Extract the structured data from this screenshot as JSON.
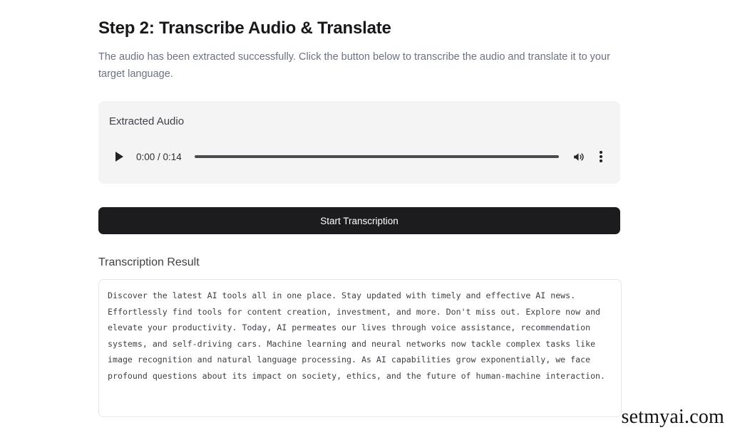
{
  "page": {
    "title": "Step 2: Transcribe Audio & Translate",
    "description": "The audio has been extracted successfully. Click the button below to transcribe the audio and translate it to your target language."
  },
  "audio_card": {
    "label": "Extracted Audio",
    "player": {
      "play_icon": "play-icon",
      "current_time": "0:00",
      "duration": "0:14",
      "time_display": "0:00 / 0:14",
      "progress_percent": 0,
      "volume_icon": "volume-icon",
      "more_icon": "more-vertical-icon"
    },
    "background_color": "#f4f4f5"
  },
  "actions": {
    "start_transcription_label": "Start Transcription",
    "start_transcription_color": "#1c1c1e"
  },
  "result": {
    "label": "Transcription Result",
    "text": "Discover the latest AI tools all in one place. Stay updated with timely and effective AI news. Effortlessly find tools for content creation, investment, and more. Don't miss out. Explore now and elevate your productivity. Today, AI permeates our lives through voice assistance, recommendation systems, and self-driving cars. Machine learning and neural networks now tackle complex tasks like image recognition and natural language processing. As AI capabilities grow exponentially, we face profound questions about its impact on society, ethics, and the future of human-machine interaction."
  },
  "watermark": {
    "text": "setmyai.com"
  }
}
